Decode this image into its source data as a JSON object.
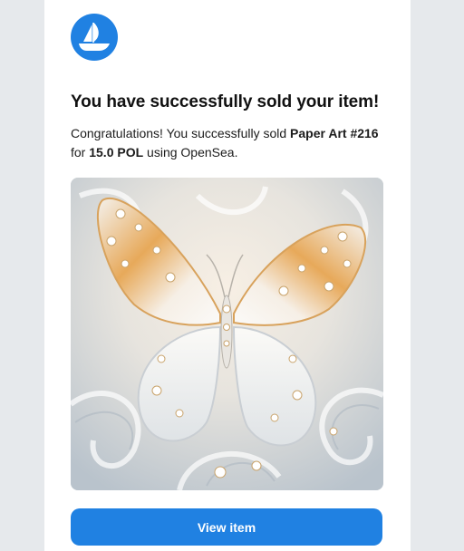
{
  "email": {
    "headline": "You have successfully sold your item!",
    "message": {
      "intro": "Congratulations! You successfully sold ",
      "item_name": "Paper Art #216",
      "for_text": " for ",
      "price": "15.0 POL",
      "outro": " using OpenSea."
    },
    "image": {
      "subject": "quilled-paper-butterfly-artwork"
    },
    "button_label": "View item"
  },
  "colors": {
    "accent": "#2081e2",
    "background": "#e6e9ec",
    "card": "#ffffff"
  },
  "icons": {
    "logo": "opensea-logo-icon"
  }
}
